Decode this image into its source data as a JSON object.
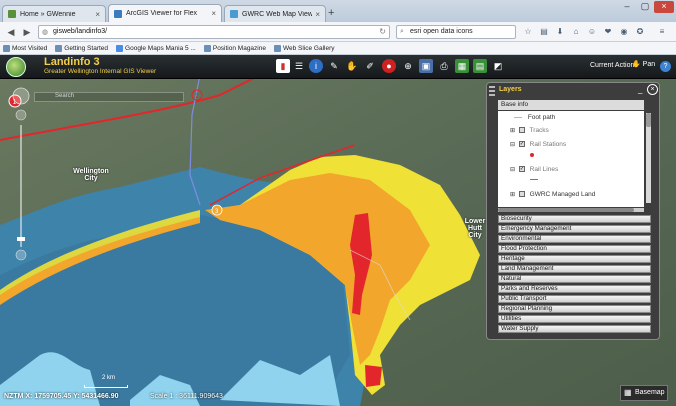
{
  "browser": {
    "tabs": [
      {
        "label": "Home » GWennie",
        "active": false
      },
      {
        "label": "ArcGIS Viewer for Flex",
        "active": true
      },
      {
        "label": "GWRC Web Map Viewer",
        "active": false
      }
    ],
    "new_tab": "+",
    "url": "gisweb/landinfo3/",
    "search_value": "esri open data icons",
    "bookmarks": [
      "Most Visited",
      "Getting Started",
      "Google Maps Mania 5 ...",
      "Position Magazine",
      "Web Slice Gallery"
    ]
  },
  "app": {
    "title": "Landinfo 3",
    "subtitle": "Greater Wellington Internal GIS Viewer",
    "current_action_label": "Current Action:",
    "current_action_value": "Pan",
    "help": "?"
  },
  "map": {
    "labels": [
      {
        "text": "Wellington\nCity",
        "key": "wellington"
      },
      {
        "text": "Lower\nHutt\nCity",
        "key": "hutt"
      }
    ],
    "search_hint": "Search",
    "coords": "NZTM X: 1759705.45   Y: 5431466.90",
    "scale": "Scale 1 : 36111.909643",
    "scalebar_label": "2 km",
    "basemap_button": "Basemap",
    "marker_1": "1",
    "marker_2": "2",
    "marker_3": "3"
  },
  "layers_panel": {
    "title": "Layers",
    "base_category": "Base info",
    "base_items": [
      {
        "label": "Foot path",
        "checked": false,
        "type": "legend"
      },
      {
        "label": "Tracks",
        "checked": false,
        "type": "layer"
      },
      {
        "label": "Rail Stations",
        "checked": true,
        "type": "layer"
      },
      {
        "label": "Rail Lines",
        "checked": true,
        "type": "layer"
      },
      {
        "label": "GWRC Managed Land",
        "checked": false,
        "type": "layer"
      }
    ],
    "categories": [
      "Biosecurity",
      "Emergency Management",
      "Environmental",
      "Flood Protection",
      "Heritage",
      "Land Management",
      "Natural",
      "Parks and Reserves",
      "Public Transport",
      "Regional Planning",
      "Utilities",
      "Water Supply"
    ]
  },
  "colors": {
    "hazard_yellow": "#efe135",
    "hazard_orange": "#f3a62c",
    "hazard_red": "#e2262b",
    "sea": "#3e83aa",
    "shallow": "#8fd3ee",
    "title_gold": "#f4d04a"
  }
}
